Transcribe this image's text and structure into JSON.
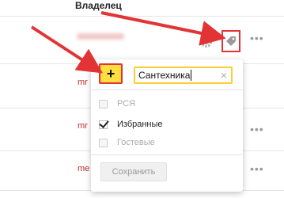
{
  "table": {
    "owner_header": "Владелец",
    "row_prefixes": [
      "mr",
      "mr",
      "me"
    ]
  },
  "popup": {
    "add_button_label": "+",
    "tag_input_value": "Сантехника",
    "clear_icon": "×",
    "options": [
      {
        "label": "РСЯ",
        "checked": false,
        "disabled": true
      },
      {
        "label": "Избранные",
        "checked": true,
        "disabled": false
      },
      {
        "label": "Гостевые",
        "checked": false,
        "disabled": true
      }
    ],
    "save_label": "Сохранить"
  },
  "icons": {
    "gear": "gear-icon",
    "tag": "tag-icon",
    "more": "more-dots-icon"
  },
  "colors": {
    "arrow": "#e23434",
    "accent_yellow": "#ffde40"
  }
}
